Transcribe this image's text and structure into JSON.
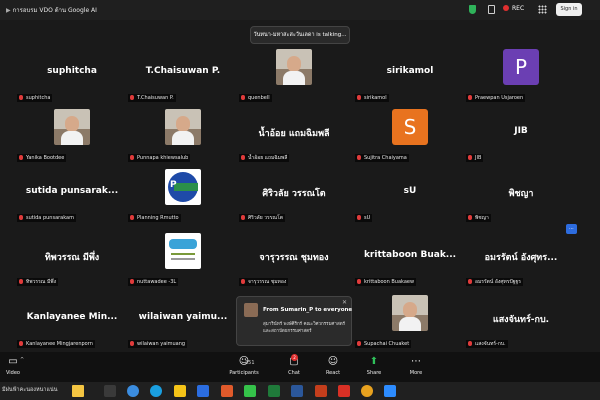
{
  "window": {
    "title": "การอบรม VDO ด้าน Google AI",
    "rec_label": "REC",
    "sign_in_label": "Sign in"
  },
  "talking_notice": "วันทนา-มหาสะสะวันเลดา is talking...",
  "tiles": [
    {
      "display_name": "suphitcha",
      "label": "suphitcha",
      "avatar": "name"
    },
    {
      "display_name": "T.Chaisuwan P.",
      "label": "T.Chaisuwan P.",
      "avatar": "name"
    },
    {
      "display_name": "",
      "label": "quenbell",
      "avatar": "photo"
    },
    {
      "display_name": "sirikamol",
      "label": "sirikamol",
      "avatar": "name"
    },
    {
      "display_name": "",
      "label": "Praewpan Usjaroen",
      "avatar": "letter",
      "letter": "P",
      "color": "#6b3fb3"
    },
    {
      "display_name": "",
      "label": "Yanika Bootdee",
      "avatar": "photo"
    },
    {
      "display_name": "",
      "label": "Punnapa khiewsalub",
      "avatar": "photo"
    },
    {
      "display_name": "น้ำอ้อย แถมฉิมพลี",
      "label": "น้ำอ้อย แถมฉิมพลี",
      "avatar": "name"
    },
    {
      "display_name": "",
      "label": "Sujitra Chaiyama",
      "avatar": "letter",
      "letter": "S",
      "color": "#e8731f"
    },
    {
      "display_name": "JIB",
      "label": "JIB",
      "avatar": "name"
    },
    {
      "display_name": "sutida punsarak...",
      "label": "sutida punsarakam",
      "avatar": "name"
    },
    {
      "display_name": "",
      "label": "Planning Rmutto",
      "avatar": "logo"
    },
    {
      "display_name": "ศิริวลัย วรรณโต",
      "label": "ศิริวลัย วรรณโต",
      "avatar": "name"
    },
    {
      "display_name": "sU",
      "label": "sU",
      "avatar": "name"
    },
    {
      "display_name": "พิชญา",
      "label": "พิชญา",
      "avatar": "name"
    },
    {
      "display_name": "ทิพวรรณ มีพึ่ง",
      "label": "ทิพวรรณ มีพึ่ง",
      "avatar": "name"
    },
    {
      "display_name": "",
      "label": "nuttawadee -3L",
      "avatar": "poster"
    },
    {
      "display_name": "จารุวรรณ ชุมทอง",
      "label": "จารุวรรณ ชุมทอง",
      "avatar": "name"
    },
    {
      "display_name": "krittaboon Buak...",
      "label": "krittaboon Buakaew",
      "avatar": "name"
    },
    {
      "display_name": "อมรรัตน์ อังศุทร...",
      "label": "อมรรัตน์ อังศุทรปัฐฐร",
      "avatar": "name"
    },
    {
      "display_name": "Kanlayanee Min...",
      "label": "Kanlayanee Mingjarenporn",
      "avatar": "name"
    },
    {
      "display_name": "wilaiwan yaimu...",
      "label": "wilaiwan yaimuang",
      "avatar": "name"
    },
    {
      "display_name": "",
      "label": "",
      "avatar": "none"
    },
    {
      "display_name": "",
      "label": "Supachai Chuaket",
      "avatar": "photo"
    },
    {
      "display_name": "แสงจันทร์-กบ.",
      "label": "แสงจันทร์-กบ.",
      "avatar": "name"
    }
  ],
  "planning_logo_text": "RMUTTO Planning",
  "chat_popup": {
    "from": "From Sumarin_P to everyone",
    "message": "สุมาริน์ทร์ พงษ์ศิริกร์ คณะวิศวกรรมศาสตร์และสถาปัตยกรรมศาสตร์"
  },
  "toolbar": {
    "video_label": "Video",
    "participants_label": "Participants",
    "participants_count": "251",
    "chat_label": "Chat",
    "chat_badge": "2",
    "react_label": "React",
    "share_label": "Share",
    "more_label": "More"
  },
  "taskbar": {
    "weather_text": "มีฝนฟ้าคะนองหนาแน่น"
  },
  "colors": {
    "background": "#1a1a1a",
    "toolbar": "#111111",
    "share_icon": "#2fc05a",
    "rec": "#e02f2f"
  }
}
